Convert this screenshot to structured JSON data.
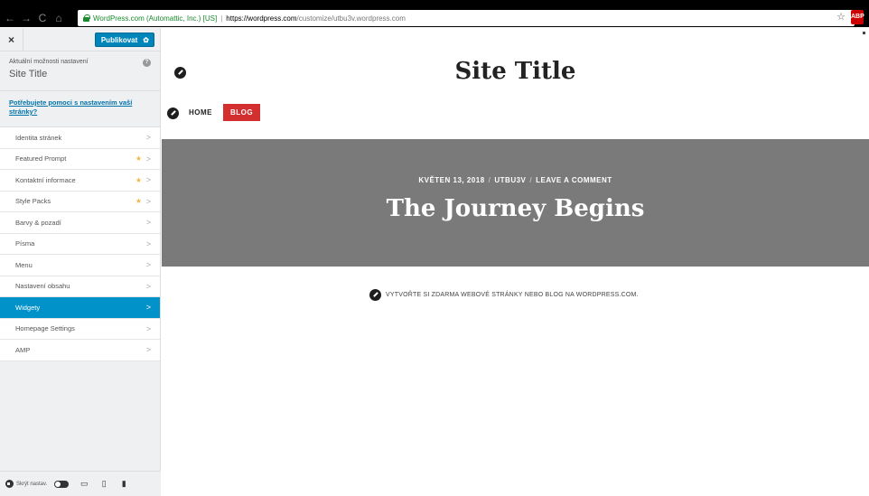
{
  "browser": {
    "back": "←",
    "forward": "→",
    "reload": "C",
    "home": "⌂",
    "secure_label": "WordPress.com (Automattic, Inc.) [US]",
    "url_domain": "https://wordpress.com",
    "url_path": "/customize/utbu3v.wordpress.com",
    "bookmark_icon": "☆",
    "extension_label": "ABP"
  },
  "sidebar": {
    "close": "×",
    "publish_label": "Publikovat",
    "gear": "✿",
    "current_label": "Aktuální možnosti nastavení",
    "current_title": "Site Title",
    "help": "?",
    "help_link": "Potřebujete pomoci s nastavením vaší stránky?",
    "items": [
      {
        "label": "Identita stránek",
        "star": ""
      },
      {
        "label": "Featured Prompt",
        "star": "★"
      },
      {
        "label": "Kontaktní informace",
        "star": "★"
      },
      {
        "label": "Style Packs",
        "star": "★"
      },
      {
        "label": "Barvy & pozadí",
        "star": ""
      },
      {
        "label": "Písma",
        "star": ""
      },
      {
        "label": "Menu",
        "star": ""
      },
      {
        "label": "Nastavení obsahu",
        "star": ""
      },
      {
        "label": "Widgety",
        "star": "",
        "active": true
      },
      {
        "label": "Homepage Settings",
        "star": ""
      },
      {
        "label": "AMP",
        "star": ""
      }
    ],
    "chevron": ">",
    "footer": {
      "hide_label": "Skrýt nastav.",
      "desktop_icon": "▭",
      "tablet_icon": "▯",
      "mobile_icon": "▮"
    }
  },
  "preview": {
    "site_title": "Site Title",
    "nav": {
      "home": "HOME",
      "blog": "BLOG"
    },
    "post_meta": {
      "date": "KVĚTEN 13, 2018",
      "slash": "/",
      "author": "UTBU3V",
      "comment": "LEAVE A COMMENT"
    },
    "post_title": "The Journey Begins",
    "footer_text": "VYTVOŘTE SI ZDARMA WEBOVÉ STRÁNKY NEBO BLOG NA WORDPRESS.COM."
  },
  "colors": {
    "accent": "#0085ba",
    "active_item": "#0092c8",
    "blog_button": "#d32f2f",
    "hero_bg": "#7a7a7a",
    "star": "#f0b849"
  }
}
